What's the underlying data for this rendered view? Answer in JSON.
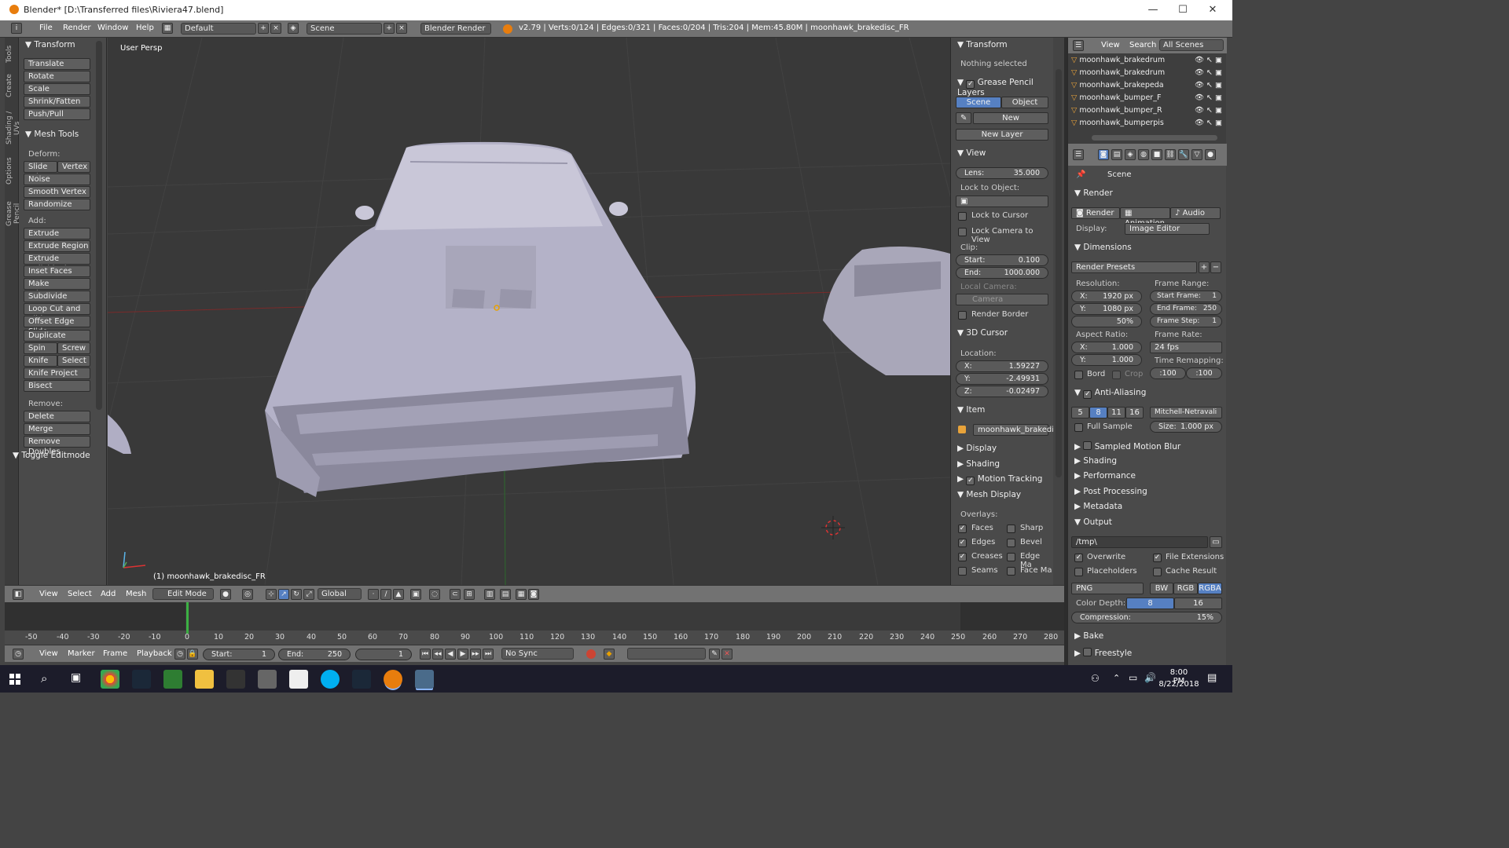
{
  "window": {
    "title": "Blender* [D:\\Transferred files\\Riviera47.blend]",
    "minimize": "—",
    "maximize": "☐",
    "close": "✕"
  },
  "infobar": {
    "menus": [
      "File",
      "Render",
      "Window",
      "Help"
    ],
    "layout": "Default",
    "scene": "Scene",
    "engine": "Blender Render",
    "stats": "v2.79 | Verts:0/124 | Edges:0/321 | Faces:0/204 | Tris:204 | Mem:45.80M | moonhawk_brakedisc_FR"
  },
  "side_tabs": [
    "Tools",
    "Create",
    "Shading / UVs",
    "Options",
    "Grease Pencil"
  ],
  "toolshelf": {
    "transform_header": "Transform",
    "transform": [
      "Translate",
      "Rotate",
      "Scale",
      "Shrink/Fatten",
      "Push/Pull"
    ],
    "mesh_tools_header": "Mesh Tools",
    "deform_label": "Deform:",
    "slide_edge": "Slide Ed",
    "vertex": "Vertex",
    "noise": "Noise",
    "smooth_vertex": "Smooth Vertex",
    "randomize": "Randomize",
    "add_label": "Add:",
    "extrude": "Extrude",
    "extrude_region": "Extrude Region",
    "extrude_individual": "Extrude Individual",
    "inset_faces": "Inset Faces",
    "make_edge_face": "Make Edge/Face",
    "subdivide": "Subdivide",
    "loop_cut": "Loop Cut and Slide",
    "offset_edge": "Offset Edge Slide",
    "duplicate": "Duplicate",
    "spin": "Spin",
    "screw": "Screw",
    "knife": "Knife",
    "select": "Select",
    "knife_project": "Knife Project",
    "bisect": "Bisect",
    "remove_label": "Remove:",
    "delete": "Delete",
    "merge": "Merge",
    "remove_doubles": "Remove Doubles",
    "toggle_editmode": "Toggle Editmode"
  },
  "viewport": {
    "view_name": "User Persp",
    "object_label": "(1) moonhawk_brakedisc_FR"
  },
  "props3d": {
    "transform_header": "Transform",
    "nothing_selected": "Nothing selected",
    "grease_header": "Grease Pencil Layers",
    "scene_btn": "Scene",
    "object_btn": "Object",
    "new_btn": "New",
    "new_layer": "New Layer",
    "view_header": "View",
    "lens_label": "Lens:",
    "lens_value": "35.000",
    "lock_object": "Lock to Object:",
    "lock_cursor": "Lock to Cursor",
    "lock_camera": "Lock Camera to View",
    "clip_label": "Clip:",
    "clip_start_label": "Start:",
    "clip_start": "0.100",
    "clip_end_label": "End:",
    "clip_end": "1000.000",
    "local_camera": "Local Camera:",
    "camera_placeholder": "Camera",
    "render_border": "Render Border",
    "cursor_header": "3D Cursor",
    "location_label": "Location:",
    "cx_label": "X:",
    "cx": "1.59227",
    "cy_label": "Y:",
    "cy": "-2.49931",
    "cz_label": "Z:",
    "cz": "-0.02497",
    "item_header": "Item",
    "item_name": "moonhawk_brakedi...",
    "display": "Display",
    "shading": "Shading",
    "motion_tracking": "Motion Tracking",
    "mesh_display": "Mesh Display",
    "overlays": "Overlays:",
    "faces": "Faces",
    "sharp": "Sharp",
    "edges": "Edges",
    "bevel": "Bevel",
    "creases": "Creases",
    "edge_ma": "Edge Ma",
    "seams": "Seams",
    "face_ma": "Face Ma"
  },
  "outliner": {
    "view": "View",
    "search": "Search",
    "filter": "All Scenes",
    "items": [
      "moonhawk_brakedrum",
      "moonhawk_brakedrum",
      "moonhawk_brakepeda",
      "moonhawk_bumper_F",
      "moonhawk_bumper_R",
      "moonhawk_bumperpis"
    ]
  },
  "props": {
    "scene": "Scene",
    "render_header": "Render",
    "render_btn": "Render",
    "animation_btn": "Animation",
    "audio_btn": "Audio",
    "display_label": "Display:",
    "display_value": "Image Editor",
    "dimensions": "Dimensions",
    "presets": "Render Presets",
    "resolution": "Resolution:",
    "res_x_label": "X:",
    "res_x": "1920 px",
    "res_y_label": "Y:",
    "res_y": "1080 px",
    "res_pct": "50%",
    "frame_range": "Frame Range:",
    "start_frame_label": "Start Frame:",
    "start_frame": "1",
    "end_frame_label": "End Frame:",
    "end_frame": "250",
    "frame_step_label": "Frame Step:",
    "frame_step": "1",
    "aspect": "Aspect Ratio:",
    "asp_x_label": "X:",
    "asp_x": "1.000",
    "asp_y_label": "Y:",
    "asp_y": "1.000",
    "frame_rate": "Frame Rate:",
    "fps": "24 fps",
    "time_remap": "Time Remapping:",
    "remap_old": ":100",
    "remap_new": ":100",
    "bord": "Bord",
    "crop": "Crop",
    "aa": "Anti-Aliasing",
    "aa_samples": [
      "5",
      "8",
      "11",
      "16"
    ],
    "aa_filter": "Mitchell-Netravali",
    "full_sample": "Full Sample",
    "size_label": "Size:",
    "size_value": "1.000 px",
    "smb": "Sampled Motion Blur",
    "shading": "Shading",
    "performance": "Performance",
    "post": "Post Processing",
    "metadata": "Metadata",
    "output": "Output",
    "path": "/tmp\\",
    "overwrite": "Overwrite",
    "file_ext": "File Extensions",
    "placeholders": "Placeholders",
    "cache": "Cache Result",
    "format": "PNG",
    "bw": "BW",
    "rgb": "RGB",
    "rgba": "RGBA",
    "color_depth": "Color Depth:",
    "depth8": "8",
    "depth16": "16",
    "compression": "Compression:",
    "compression_value": "15%",
    "bake": "Bake",
    "freestyle": "Freestyle"
  },
  "vpheader": {
    "view": "View",
    "select": "Select",
    "add": "Add",
    "mesh": "Mesh",
    "mode": "Edit Mode",
    "orientation": "Global"
  },
  "timeline": {
    "ticks": [
      "-50",
      "-40",
      "-30",
      "-20",
      "-10",
      "0",
      "10",
      "20",
      "30",
      "40",
      "50",
      "60",
      "70",
      "80",
      "90",
      "100",
      "110",
      "120",
      "130",
      "140",
      "150",
      "160",
      "170",
      "180",
      "190",
      "200",
      "210",
      "220",
      "230",
      "240",
      "250",
      "260",
      "270",
      "280"
    ],
    "current_frame": 0
  },
  "tlheader": {
    "view": "View",
    "marker": "Marker",
    "frame": "Frame",
    "playback": "Playback",
    "start_label": "Start:",
    "start": "1",
    "end_label": "End:",
    "end": "250",
    "current": "1",
    "sync": "No Sync"
  },
  "taskbar": {
    "time": "8:00 PM",
    "date": "8/22/2018"
  },
  "colors": {
    "accent": "#5680c2",
    "viewport_bg": "#393939",
    "mesh": "#b4b2c8"
  }
}
